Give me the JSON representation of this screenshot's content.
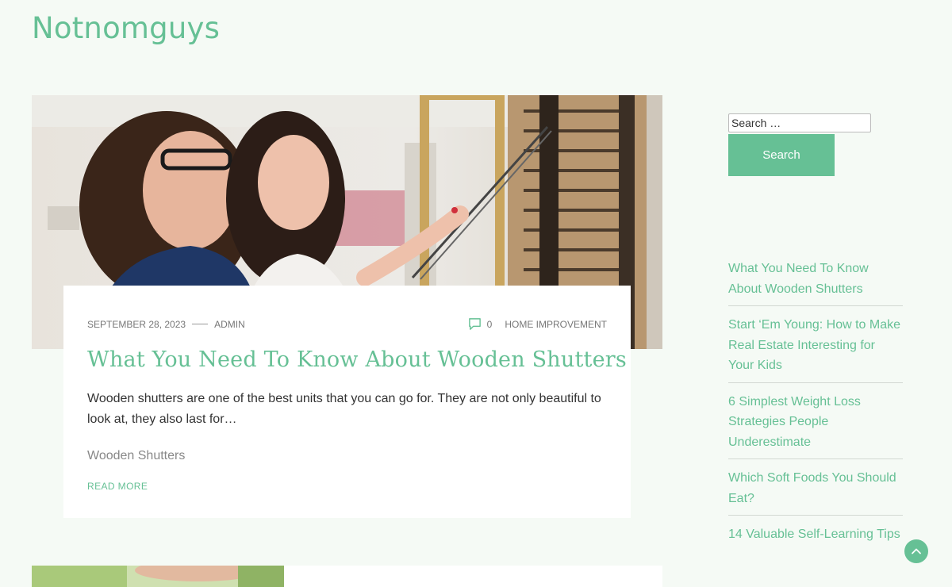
{
  "site": {
    "title": "Notnomguys"
  },
  "post": {
    "date": "September 28, 2023",
    "author": "admin",
    "comment_count": "0",
    "category": "Home Improvement",
    "title": "What You Need To Know About Wooden Shutters",
    "excerpt": "Wooden shutters are one of the best units that you can go for. They are not only beautiful to look at, they also last for…",
    "tag": "Wooden Shutters",
    "read_more": "Read More"
  },
  "sidebar": {
    "search_placeholder": "Search …",
    "search_button": "Search",
    "recent_posts": [
      "What You Need To Know About Wooden Shutters",
      "Start ‘Em Young: How to Make Real Estate Interesting for Your Kids",
      "6 Simplest Weight Loss Strategies People Underestimate",
      "Which Soft Foods You Should Eat?",
      "14 Valuable Self-Learning Tips"
    ]
  },
  "colors": {
    "accent": "#66c095",
    "background": "#f5faf5"
  },
  "icons": {
    "comment": "comment-icon",
    "back_to_top": "chevron-up-icon"
  }
}
